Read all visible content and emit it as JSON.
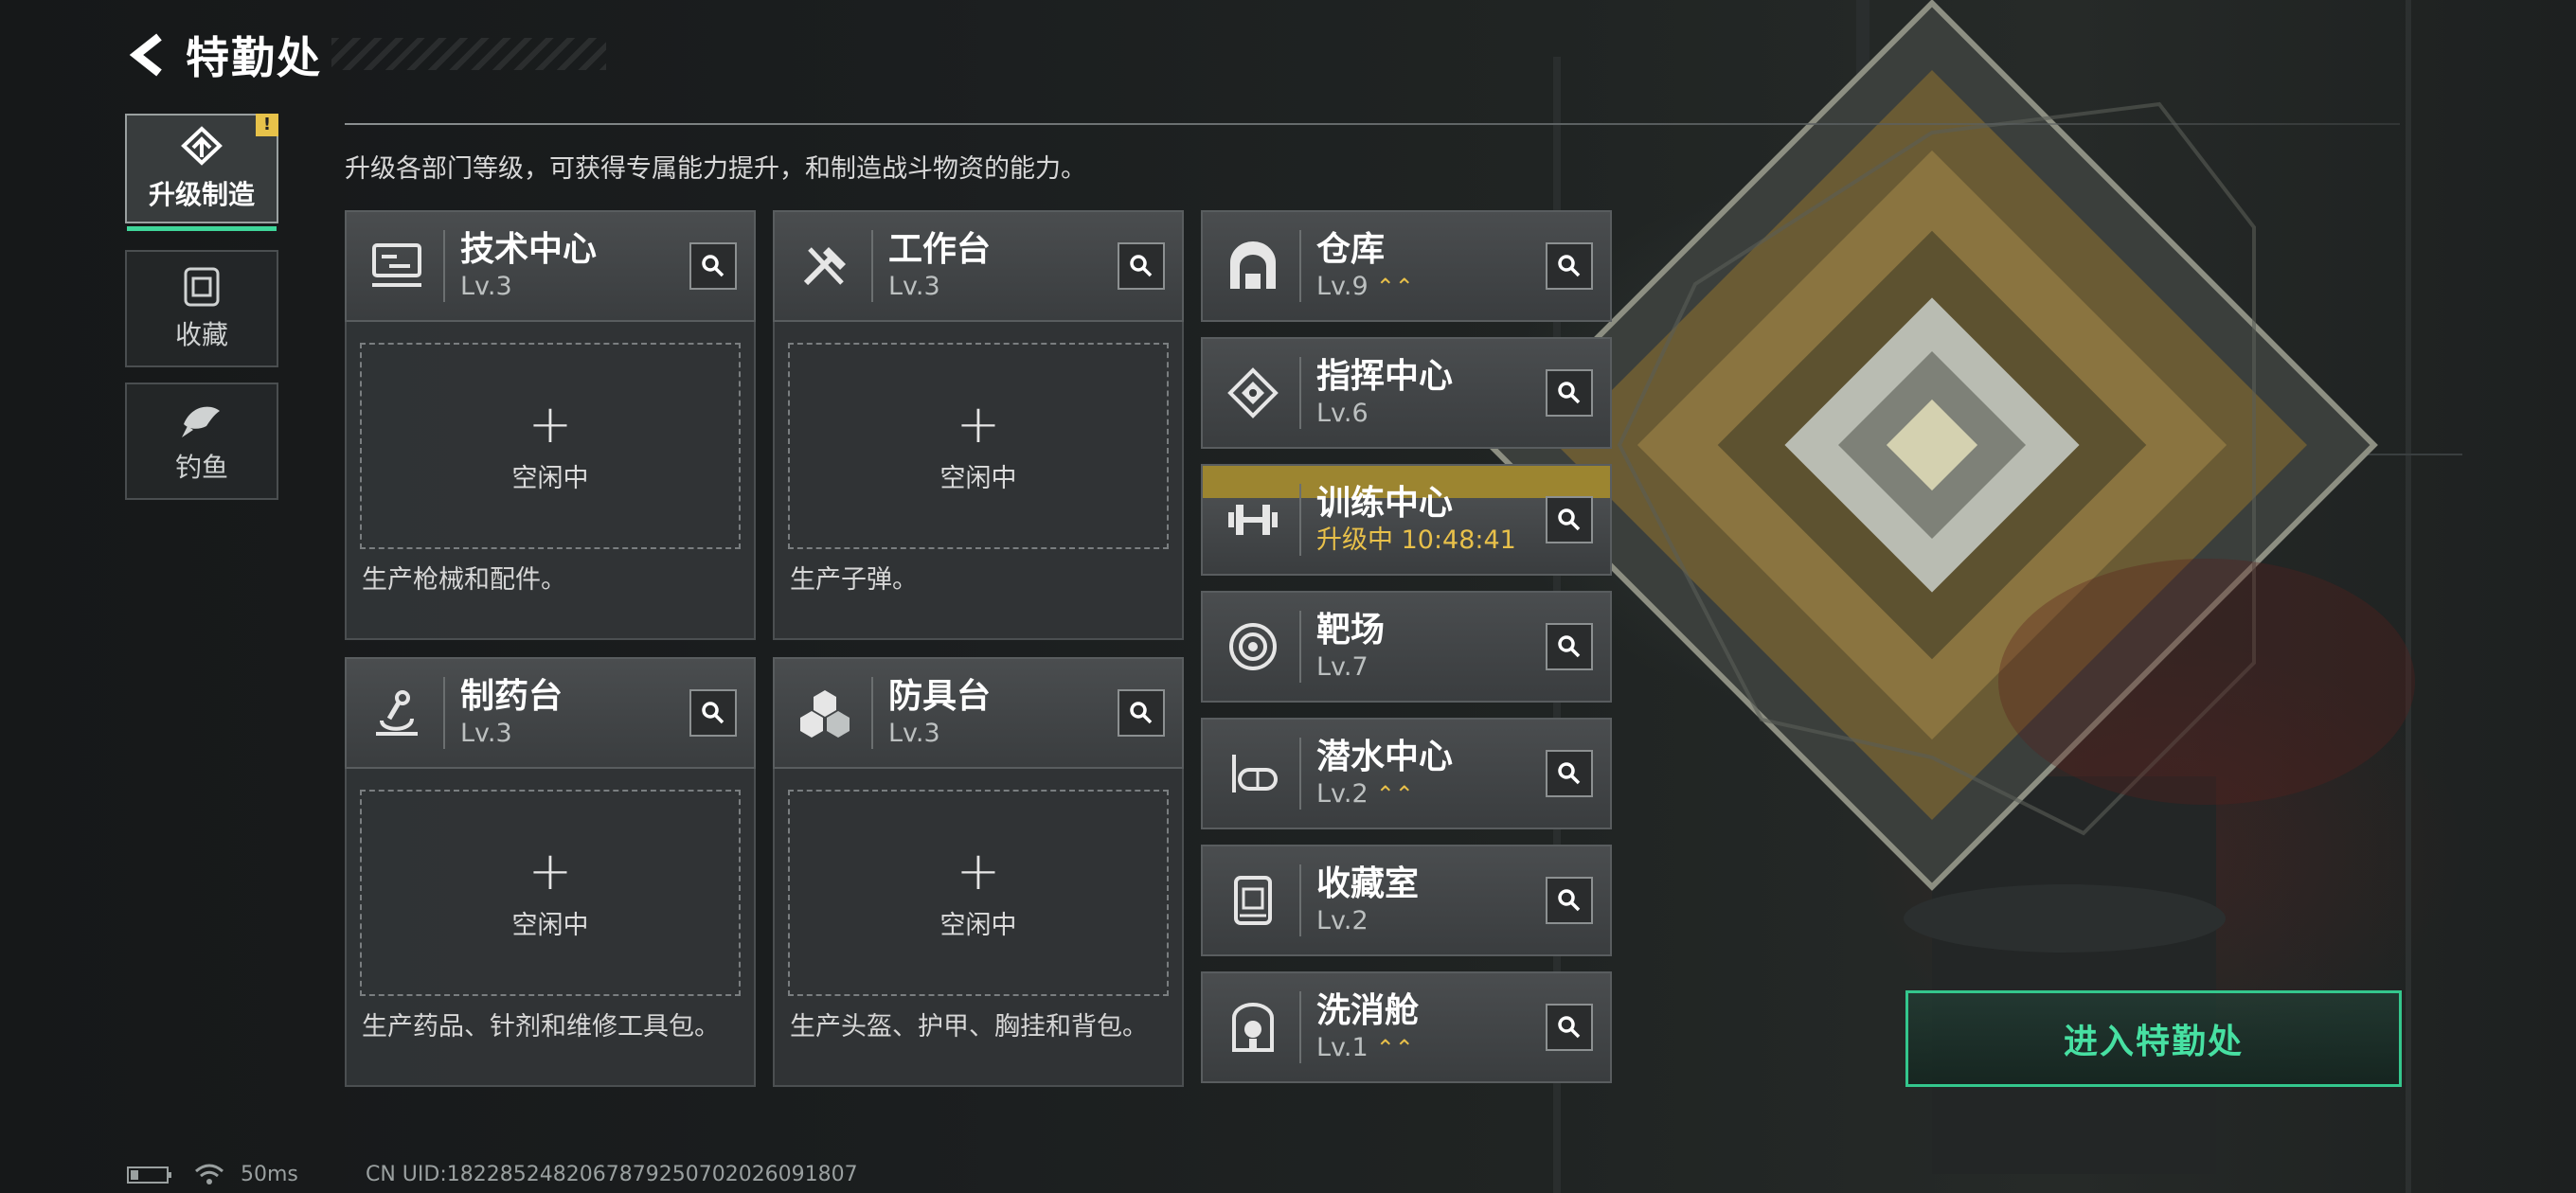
{
  "header": {
    "title": "特勤处"
  },
  "sidebar": {
    "items": [
      {
        "label": "升级制造",
        "icon": "upgrade-arrow-icon",
        "active": true,
        "badge": "!"
      },
      {
        "label": "收藏",
        "icon": "collection-capsule-icon",
        "active": false
      },
      {
        "label": "钓鱼",
        "icon": "fish-icon",
        "active": false
      }
    ]
  },
  "description": "升级各部门等级，可获得专属能力提升，和制造战斗物资的能力。",
  "production": [
    {
      "name": "技术中心",
      "level": "Lv.3",
      "slot": "空闲中",
      "produces": "生产枪械和配件。",
      "icon": "tech-center-icon"
    },
    {
      "name": "工作台",
      "level": "Lv.3",
      "slot": "空闲中",
      "produces": "生产子弹。",
      "icon": "workbench-tools-icon"
    },
    {
      "name": "制药台",
      "level": "Lv.3",
      "slot": "空闲中",
      "produces": "生产药品、针剂和维修工具包。",
      "icon": "microscope-icon"
    },
    {
      "name": "防具台",
      "level": "Lv.3",
      "slot": "空闲中",
      "produces": "生产头盔、护甲、胸挂和背包。",
      "icon": "armor-cubes-icon"
    }
  ],
  "departments": [
    {
      "name": "仓库",
      "level": "Lv.9",
      "upgradable": true,
      "icon": "warehouse-icon"
    },
    {
      "name": "指挥中心",
      "level": "Lv.6",
      "upgradable": false,
      "icon": "command-chip-icon"
    },
    {
      "name": "训练中心",
      "status": "升级中 10:48:41",
      "upgrading": true,
      "icon": "dumbbell-icon"
    },
    {
      "name": "靶场",
      "level": "Lv.7",
      "upgradable": false,
      "icon": "target-icon"
    },
    {
      "name": "潜水中心",
      "level": "Lv.2",
      "upgradable": true,
      "icon": "diving-mask-icon"
    },
    {
      "name": "收藏室",
      "level": "Lv.2",
      "upgradable": false,
      "icon": "collection-room-icon"
    },
    {
      "name": "洗消舱",
      "level": "Lv.1",
      "upgradable": true,
      "icon": "decon-pod-icon"
    }
  ],
  "upgrade_marker": "⌃⌃",
  "enter_button": "进入特勤处",
  "status_bar": {
    "ping": "50ms",
    "uid": "CN UID:1822852482067879250702026091807"
  },
  "colors": {
    "accent": "#3fd69a",
    "upgrade": "#e8c04a",
    "badge": "#e7c24a"
  }
}
